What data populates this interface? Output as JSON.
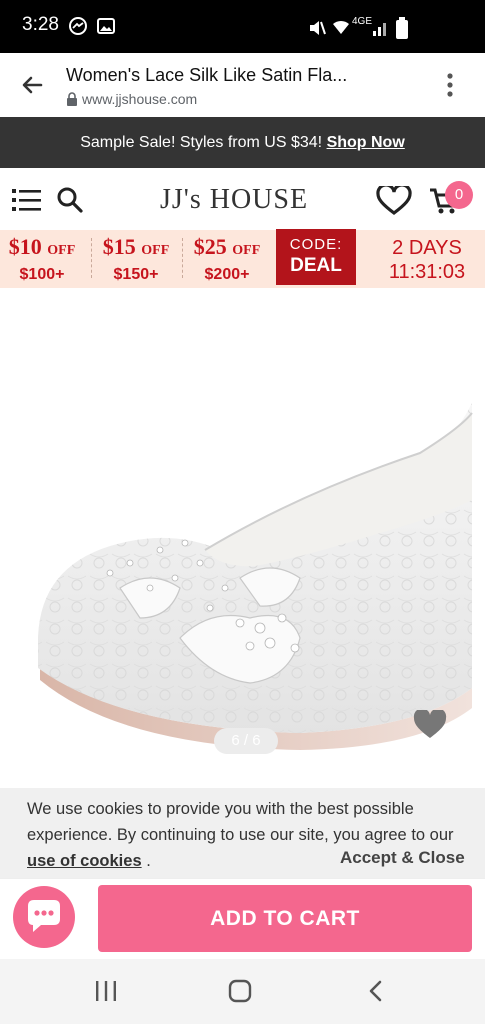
{
  "status_bar": {
    "time": "3:28",
    "network": "4GE"
  },
  "browser": {
    "page_title": "Women's Lace Silk Like Satin Fla...",
    "url": "www.jjshouse.com"
  },
  "sale_banner": {
    "text": "Sample Sale! Styles from US $34!",
    "link": "Shop Now"
  },
  "site_header": {
    "logo": "JJ's HOUSE",
    "cart_count": "0"
  },
  "promo": {
    "deals": [
      {
        "off": "$10",
        "off_suffix": "OFF",
        "min": "$100+"
      },
      {
        "off": "$15",
        "off_suffix": "OFF",
        "min": "$150+"
      },
      {
        "off": "$25",
        "off_suffix": "OFF",
        "min": "$200+"
      }
    ],
    "code_label": "CODE:",
    "code_value": "DEAL",
    "countdown_days": "2 DAYS",
    "countdown_time": "11:31:03"
  },
  "gallery": {
    "counter": "6 / 6"
  },
  "cookie": {
    "text_before": "We use cookies to provide you with the best possible experience. By continuing to use our site, you agree to our ",
    "link": "use of cookies",
    "text_after": " .",
    "accept": "Accept & Close"
  },
  "cart": {
    "add_label": "ADD TO CART"
  },
  "colors": {
    "accent_pink": "#f4678e",
    "promo_red": "#c6141d",
    "code_bg": "#b3141b",
    "banner_bg": "#343434"
  }
}
